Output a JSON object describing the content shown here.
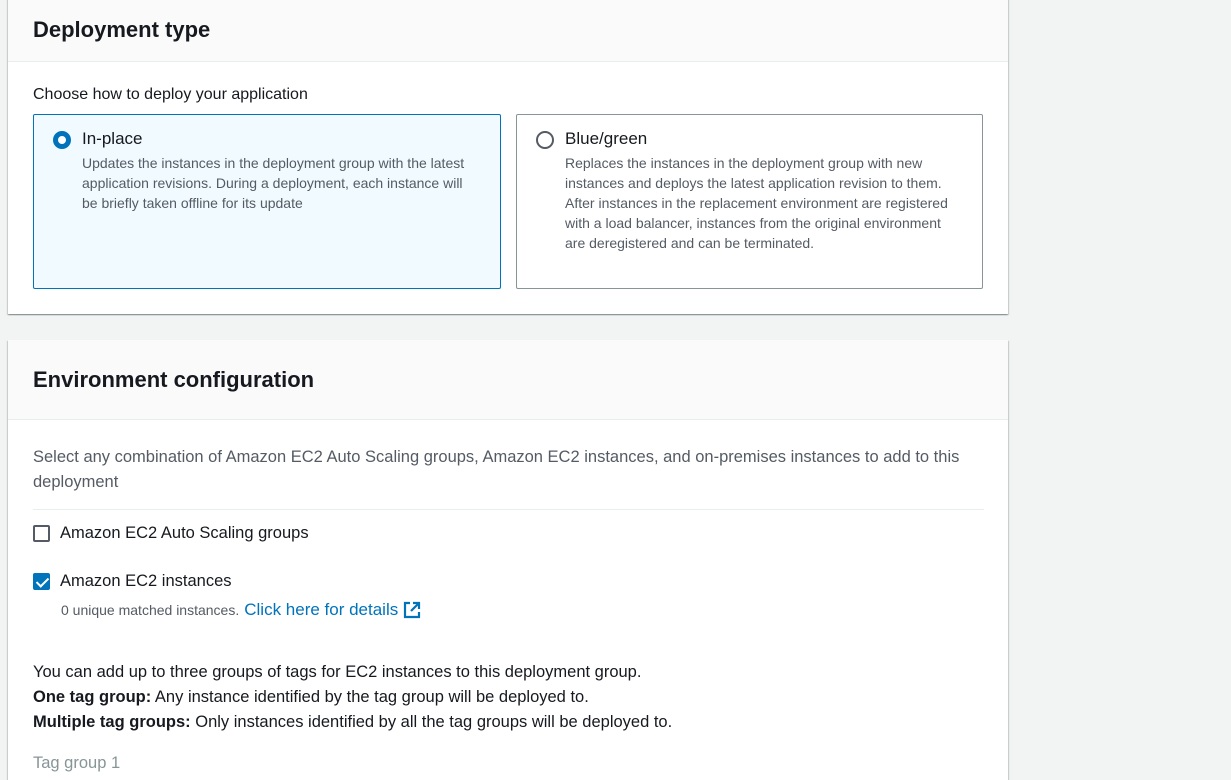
{
  "deployment_type": {
    "title": "Deployment type",
    "prompt": "Choose how to deploy your application",
    "options": [
      {
        "label": "In-place",
        "description": "Updates the instances in the deployment group with the latest application revisions. During a deployment, each instance will be briefly taken offline for its update",
        "selected": true
      },
      {
        "label": "Blue/green",
        "description": "Replaces the instances in the deployment group with new instances and deploys the latest application revision to them. After instances in the replacement environment are registered with a load balancer, instances from the original environment are deregistered and can be terminated.",
        "selected": false
      }
    ]
  },
  "environment": {
    "title": "Environment configuration",
    "intro": "Select any combination of Amazon EC2 Auto Scaling groups, Amazon EC2 instances, and on-premises instances to add to this deployment",
    "checkboxes": [
      {
        "label": "Amazon EC2 Auto Scaling groups",
        "checked": false
      },
      {
        "label": "Amazon EC2 instances",
        "checked": true
      }
    ],
    "matched_text": "0 unique matched instances.",
    "details_link": "Click here for details",
    "tags_intro": "You can add up to three groups of tags for EC2 instances to this deployment group.",
    "one_tag_bold": "One tag group:",
    "one_tag_text": " Any instance identified by the tag group will be deployed to.",
    "multi_tag_bold": "Multiple tag groups:",
    "multi_tag_text": " Only instances identified by all the tag groups will be deployed to.",
    "tag_group_label": "Tag group 1"
  },
  "colors": {
    "accent": "#0073bb",
    "selected_tile_bg": "#f1faff",
    "muted_text": "#545b64"
  }
}
